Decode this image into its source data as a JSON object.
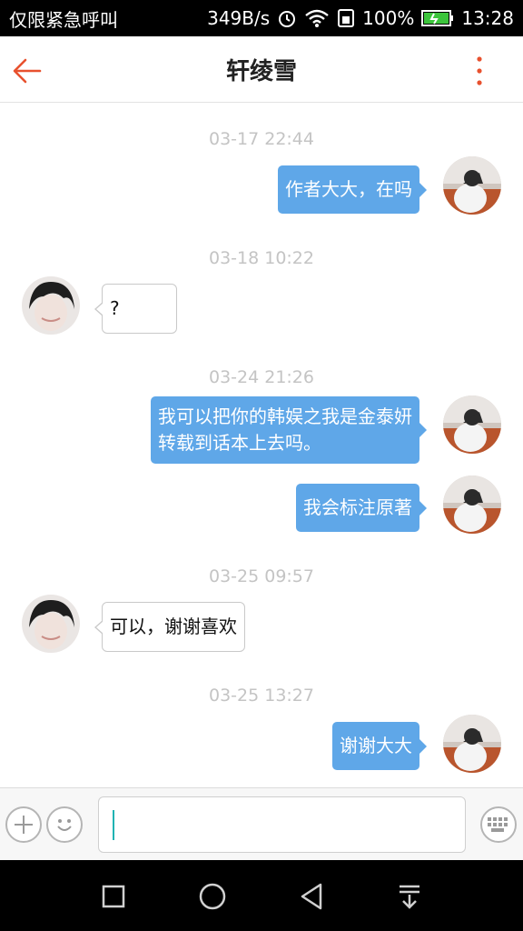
{
  "status_bar": {
    "carrier": "仅限紧急呼叫",
    "speed": "349B/s",
    "battery": "100%",
    "time": "13:28"
  },
  "header": {
    "title": "轩绫雪",
    "back_icon": "arrow-left-icon",
    "more_icon": "more-vertical-icon",
    "accent_color": "#e8512e"
  },
  "messages": [
    {
      "time": "03-17 22:44",
      "side": "out",
      "lines": [
        "作者大大，在吗"
      ]
    },
    {
      "time": "03-18 10:22",
      "side": "in",
      "lines": [
        "?"
      ]
    },
    {
      "time": "03-24 21:26",
      "side": "out",
      "lines": [
        "我可以把你的韩娱之我是金泰妍",
        "转载到话本上去吗。"
      ]
    },
    {
      "time": "",
      "side": "out",
      "lines": [
        "我会标注原著"
      ]
    },
    {
      "time": "03-25 09:57",
      "side": "in",
      "lines": [
        "可以，谢谢喜欢"
      ]
    },
    {
      "time": "03-25 13:27",
      "side": "out",
      "lines": [
        "谢谢大大"
      ]
    }
  ],
  "input": {
    "value": "",
    "add_icon": "plus-circle-icon",
    "emoji_icon": "smiley-icon",
    "keyboard_icon": "keyboard-icon"
  },
  "colors": {
    "outgoing_bubble": "#5fa7e8",
    "timestamp": "#c4c4c4"
  }
}
